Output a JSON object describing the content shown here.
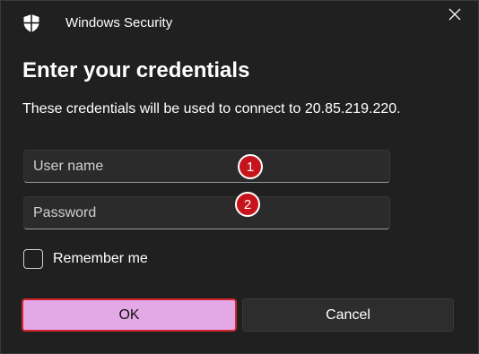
{
  "window": {
    "app_title": "Windows Security",
    "close_label": "Close"
  },
  "content": {
    "heading": "Enter your credentials",
    "description": "These credentials will be used to connect to 20.85.219.220."
  },
  "form": {
    "username": {
      "placeholder": "User name",
      "value": ""
    },
    "password": {
      "placeholder": "Password",
      "value": ""
    },
    "remember_me": {
      "label": "Remember me",
      "checked": false
    }
  },
  "annotations": {
    "marker_1": "1",
    "marker_2": "2",
    "color": "#c7141c"
  },
  "buttons": {
    "ok": "OK",
    "cancel": "Cancel"
  },
  "colors": {
    "background": "#202020",
    "ok_fill": "#e3a8e6",
    "ok_outline": "#d0242e"
  },
  "icons": {
    "app": "shield-icon",
    "close": "close-icon"
  }
}
